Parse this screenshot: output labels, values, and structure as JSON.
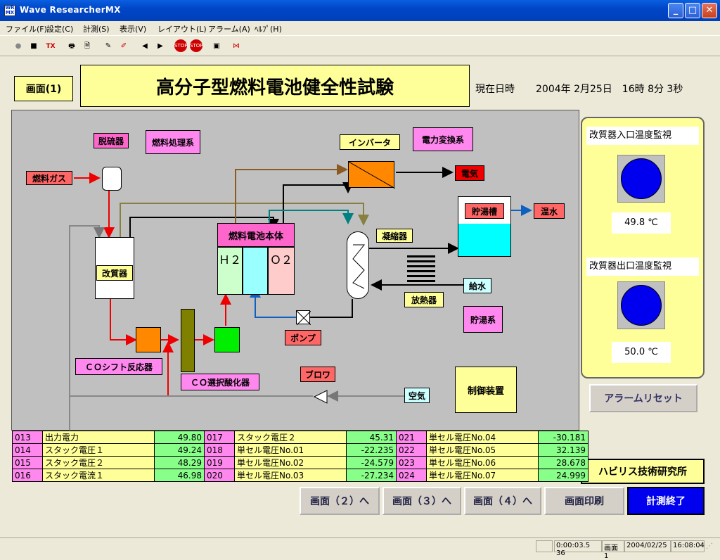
{
  "window": {
    "title": "Wave ResearcherMX",
    "app_icon": "WR MX"
  },
  "menu": [
    "ファイル(F)",
    "設定(C)",
    "計測(S)",
    "表示(V)",
    "レイアウト(L)",
    "アラーム(A)",
    "ﾍﾙﾌﾟ(H)"
  ],
  "toolbar": {
    "tx_label": "TX",
    "stop_label": "STOP"
  },
  "screen": {
    "page_label": "画面(1)",
    "title": "高分子型燃料電池健全性試験",
    "datetime_label": "現在日時",
    "datetime_value": "2004年 2月25日　16時 8分 3秒"
  },
  "diagram": {
    "desulfurizer": "脱硫器",
    "fuel_system": "燃料処理系",
    "fuel_gas": "燃料ガス",
    "inverter": "インバータ",
    "power_system": "電力変換系",
    "electricity": "電気",
    "hot_tank": "貯湯槽",
    "hot_water": "温水",
    "condenser": "凝縮器",
    "cell_body": "燃料電池本体",
    "h2": "Ｈ２",
    "o2": "Ｏ２",
    "reformer": "改質器",
    "feed_water": "給水",
    "radiator": "放熱器",
    "hot_storage_system": "貯湯系",
    "pump": "ポンプ",
    "co_shift": "ＣＯシフト反応器",
    "co_select": "ＣＯ選択酸化器",
    "blower": "ブロワ",
    "air": "空気",
    "controller": "制御装置"
  },
  "monitor": {
    "inlet_label": "改質器入口温度監視",
    "inlet_value": "49.8 ℃",
    "outlet_label": "改質器出口温度監視",
    "outlet_value": "50.0 ℃",
    "alarm_reset": "アラームリセット",
    "company": "ハビリス技術研究所",
    "lamp_color": "#0000ee"
  },
  "table": [
    [
      {
        "no": "013",
        "name": "出力電力",
        "val": "49.80"
      },
      {
        "no": "017",
        "name": "スタック電圧２",
        "val": "45.31"
      },
      {
        "no": "021",
        "name": "単セル電圧No.04",
        "val": "-30.181"
      }
    ],
    [
      {
        "no": "014",
        "name": "スタック電圧１",
        "val": "49.24"
      },
      {
        "no": "018",
        "name": "単セル電圧No.01",
        "val": "-22.235"
      },
      {
        "no": "022",
        "name": "単セル電圧No.05",
        "val": "32.139"
      }
    ],
    [
      {
        "no": "015",
        "name": "スタック電圧２",
        "val": "48.29"
      },
      {
        "no": "019",
        "name": "単セル電圧No.02",
        "val": "-24.579"
      },
      {
        "no": "023",
        "name": "単セル電圧No.06",
        "val": "28.678"
      }
    ],
    [
      {
        "no": "016",
        "name": "スタック電流１",
        "val": "46.98"
      },
      {
        "no": "020",
        "name": "単セル電圧No.03",
        "val": "-27.234"
      },
      {
        "no": "024",
        "name": "単セル電圧No.07",
        "val": "24.999"
      }
    ]
  ],
  "nav": {
    "screen2": "画面（２）へ",
    "screen3": "画面（３）へ",
    "screen4": "画面（４）へ",
    "print": "画面印刷",
    "end": "計測終了"
  },
  "status": {
    "elapsed": "0:00:03.5 36",
    "screen": "画面 1",
    "date": "2004/02/25",
    "time": "16:08:04"
  }
}
